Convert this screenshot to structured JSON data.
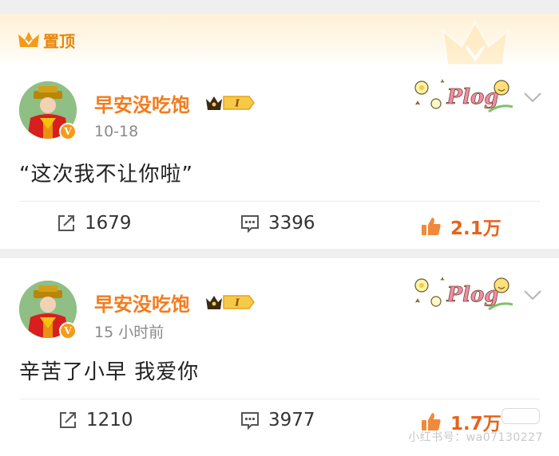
{
  "pinned": {
    "label": "置顶"
  },
  "posts": [
    {
      "username": "早安没吃饱",
      "level": "I",
      "time": "10-18",
      "text": "“这次我不让你啦”",
      "repost_count": "1679",
      "comment_count": "3396",
      "like_count": "2.1万",
      "sticker_text": "Plog"
    },
    {
      "username": "早安没吃饱",
      "level": "I",
      "time": "15 小时前",
      "text": "辛苦了小早 我爱你",
      "repost_count": "1210",
      "comment_count": "3977",
      "like_count": "1.7万",
      "sticker_text": "Plog"
    }
  ],
  "watermark": "小红书号：wa07130227",
  "colors": {
    "accent": "#f37b1d",
    "like": "#e8621a",
    "meta": "#8a8a8a",
    "background": "#efefef"
  }
}
